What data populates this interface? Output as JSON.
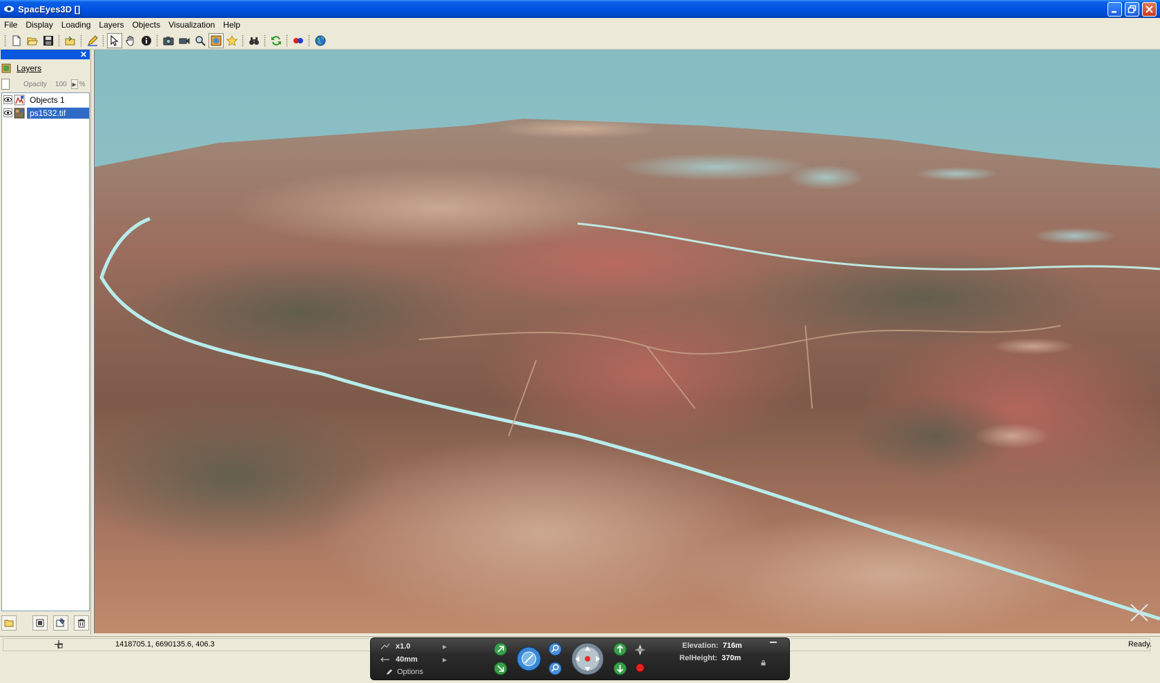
{
  "window": {
    "title": "SpacEyes3D []",
    "accent": "#0054e3"
  },
  "menu": {
    "items": [
      {
        "label": "File"
      },
      {
        "label": "Display"
      },
      {
        "label": "Loading"
      },
      {
        "label": "Layers"
      },
      {
        "label": "Objects"
      },
      {
        "label": "Visualization"
      },
      {
        "label": "Help"
      }
    ]
  },
  "toolbar": {
    "buttons": [
      "new-icon",
      "open-icon",
      "save-icon",
      "load-project-icon",
      "edit-icon",
      "select-arrow-icon",
      "pan-hand-icon",
      "info-icon",
      "camera-icon",
      "video-icon",
      "zoom-view-icon",
      "globe-view-icon",
      "star-icon",
      "binoculars-icon",
      "refresh-icon",
      "anaglyph-icon",
      "world-icon"
    ]
  },
  "layers_panel": {
    "tab_label": "Layers",
    "opacity_label": "Opacity",
    "opacity_value": "100",
    "opacity_unit": "%",
    "layers": [
      {
        "name": "Objects 1",
        "visible": true,
        "selected": false,
        "type": "objects"
      },
      {
        "name": "ps1532.tif",
        "visible": true,
        "selected": true,
        "type": "raster"
      }
    ]
  },
  "status_bar": {
    "coordinates": "1418705.1, 6690135.6, 406.3",
    "status": "Ready."
  },
  "nav_widget": {
    "speed": "x1.0",
    "focal": "40mm",
    "options_label": "Options",
    "elevation_label": "Elevation:",
    "elevation_value": "716m",
    "relheight_label": "RelHeight:",
    "relheight_value": "370m"
  }
}
